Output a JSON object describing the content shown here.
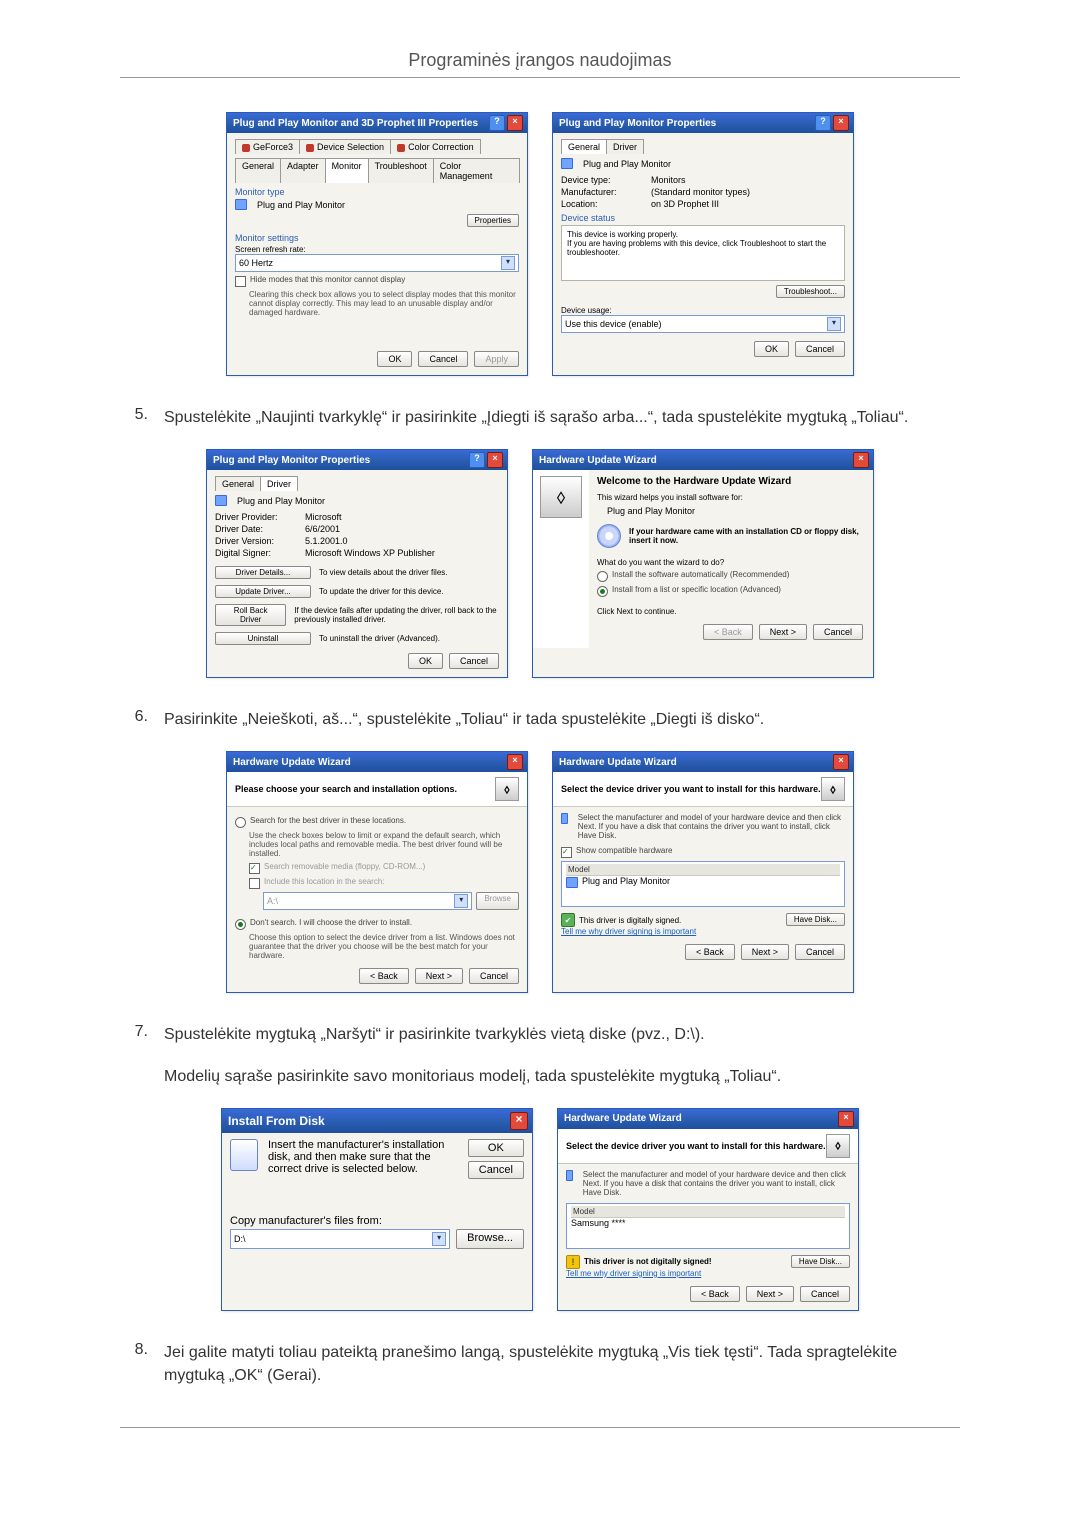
{
  "page_title": "Programinės įrangos naudojimas",
  "s1": {
    "dlg_left": {
      "title": "Plug and Play Monitor and 3D Prophet III Properties",
      "tabs_row1": [
        "GeForce3",
        "Device Selection",
        "Color Correction"
      ],
      "tabs_row2": [
        "General",
        "Adapter",
        "Monitor",
        "Troubleshoot",
        "Color Management"
      ],
      "grp_type": "Monitor type",
      "mon_name": "Plug and Play Monitor",
      "btn_props": "Properties",
      "grp_settings": "Monitor settings",
      "lbl_refresh": "Screen refresh rate:",
      "refresh_value": "60 Hertz",
      "chk_hide": "Hide modes that this monitor cannot display",
      "hide_help": "Clearing this check box allows you to select display modes that this monitor cannot display correctly. This may lead to an unusable display and/or damaged hardware.",
      "ok": "OK",
      "cancel": "Cancel",
      "apply": "Apply"
    },
    "dlg_right": {
      "title": "Plug and Play Monitor Properties",
      "tab_general": "General",
      "tab_driver": "Driver",
      "mon_name": "Plug and Play Monitor",
      "lbl_devtype": "Device type:",
      "val_devtype": "Monitors",
      "lbl_mfr": "Manufacturer:",
      "val_mfr": "(Standard monitor types)",
      "lbl_loc": "Location:",
      "val_loc": "on 3D Prophet III",
      "grp_status": "Device status",
      "status_text": "This device is working properly.\nIf you are having problems with this device, click Troubleshoot to start the troubleshooter.",
      "btn_trouble": "Troubleshoot...",
      "lbl_usage": "Device usage:",
      "usage_value": "Use this device (enable)",
      "ok": "OK",
      "cancel": "Cancel"
    }
  },
  "step5": {
    "num": "5.",
    "text": "Spustelėkite „Naujinti tvarkyklę“ ir pasirinkite „Įdiegti iš sąrašo arba...“, tada spustelėkite mygtuką „Toliau“."
  },
  "s2": {
    "dlg_left": {
      "title": "Plug and Play Monitor Properties",
      "tab_general": "General",
      "tab_driver": "Driver",
      "mon_name": "Plug and Play Monitor",
      "lbl_prov": "Driver Provider:",
      "val_prov": "Microsoft",
      "lbl_date": "Driver Date:",
      "val_date": "6/6/2001",
      "lbl_ver": "Driver Version:",
      "val_ver": "5.1.2001.0",
      "lbl_sign": "Digital Signer:",
      "val_sign": "Microsoft Windows XP Publisher",
      "btn_details": "Driver Details...",
      "btn_details_help": "To view details about the driver files.",
      "btn_update": "Update Driver...",
      "btn_update_help": "To update the driver for this device.",
      "btn_roll": "Roll Back Driver",
      "btn_roll_help": "If the device fails after updating the driver, roll back to the previously installed driver.",
      "btn_unin": "Uninstall",
      "btn_unin_help": "To uninstall the driver (Advanced).",
      "ok": "OK",
      "cancel": "Cancel"
    },
    "dlg_right": {
      "title": "Hardware Update Wizard",
      "welcome": "Welcome to the Hardware Update Wizard",
      "line1": "This wizard helps you install software for:",
      "device": "Plug and Play Monitor",
      "cd_line": "If your hardware came with an installation CD or floppy disk, insert it now.",
      "question": "What do you want the wizard to do?",
      "opt1": "Install the software automatically (Recommended)",
      "opt2": "Install from a list or specific location (Advanced)",
      "cont": "Click Next to continue.",
      "back": "< Back",
      "next": "Next >",
      "cancel": "Cancel"
    }
  },
  "step6": {
    "num": "6.",
    "text": "Pasirinkite „Neieškoti, aš...“, spustelėkite „Toliau“ ir tada spustelėkite „Diegti iš disko“."
  },
  "s3": {
    "dlg_left": {
      "title": "Hardware Update Wizard",
      "banner": "Please choose your search and installation options.",
      "opt1": "Search for the best driver in these locations.",
      "opt1_help": "Use the check boxes below to limit or expand the default search, which includes local paths and removable media. The best driver found will be installed.",
      "chk_remov": "Search removable media (floppy, CD-ROM...)",
      "chk_loc": "Include this location in the search:",
      "path_value": "A:\\",
      "browse": "Browse",
      "opt2": "Don't search. I will choose the driver to install.",
      "opt2_help": "Choose this option to select the device driver from a list. Windows does not guarantee that the driver you choose will be the best match for your hardware.",
      "back": "< Back",
      "next": "Next >",
      "cancel": "Cancel"
    },
    "dlg_right": {
      "title": "Hardware Update Wizard",
      "banner": "Select the device driver you want to install for this hardware.",
      "help": "Select the manufacturer and model of your hardware device and then click Next. If you have a disk that contains the driver you want to install, click Have Disk.",
      "chk_compat": "Show compatible hardware",
      "hdr_model": "Model",
      "model1": "Plug and Play Monitor",
      "signed": "This driver is digitally signed.",
      "signed_link": "Tell me why driver signing is important",
      "have_disk": "Have Disk...",
      "back": "< Back",
      "next": "Next >",
      "cancel": "Cancel"
    }
  },
  "step7a": {
    "num": "7.",
    "text": "Spustelėkite mygtuką „Naršyti“ ir pasirinkite tvarkyklės vietą diske (pvz., D:\\)."
  },
  "step7b": {
    "text": "Modelių sąraše pasirinkite savo monitoriaus modelį, tada spustelėkite mygtuką „Toliau“."
  },
  "s4": {
    "dlg_left": {
      "title": "Install From Disk",
      "help": "Insert the manufacturer's installation disk, and then make sure that the correct drive is selected below.",
      "ok": "OK",
      "cancel": "Cancel",
      "lbl_copy": "Copy manufacturer's files from:",
      "path_value": "D:\\",
      "browse": "Browse..."
    },
    "dlg_right": {
      "title": "Hardware Update Wizard",
      "banner": "Select the device driver you want to install for this hardware.",
      "help": "Select the manufacturer and model of your hardware device and then click Next. If you have a disk that contains the driver you want to install, click Have Disk.",
      "hdr_model": "Model",
      "model1": "Samsung ****",
      "not_signed": "This driver is not digitally signed!",
      "signed_link": "Tell me why driver signing is important",
      "have_disk": "Have Disk...",
      "back": "< Back",
      "next": "Next >",
      "cancel": "Cancel"
    }
  },
  "step8": {
    "num": "8.",
    "text": "Jei galite matyti toliau pateiktą pranešimo langą, spustelėkite mygtuką „Vis tiek tęsti“. Tada spragtelėkite mygtuką „OK“ (Gerai)."
  }
}
